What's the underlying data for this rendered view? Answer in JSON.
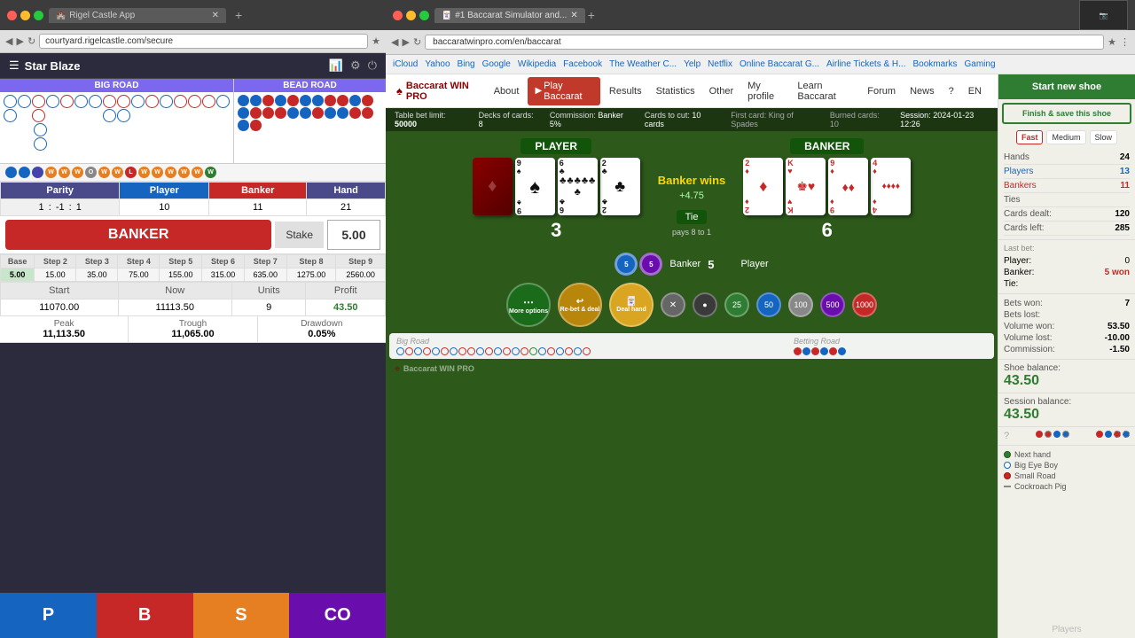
{
  "browser": {
    "tab1": "#1 Baccarat Simulator and...",
    "tab1_url": "baccaratwinpro.com/en/baccarat",
    "left_tab": "Rigel Castle App",
    "left_url": "courtyard.rigelcastle.com/secure"
  },
  "left_panel": {
    "title": "Star Blaze",
    "big_road_label": "BIG ROAD",
    "bead_road_label": "BEAD ROAD",
    "parity_label": "Parity",
    "player_label": "Player",
    "banker_label": "Banker",
    "hand_label": "Hand",
    "parity_1": "1",
    "parity_sep": ":",
    "parity_neg1": "-1",
    "parity_colon2": ":",
    "parity_1b": "1",
    "player_val": "10",
    "banker_val": "11",
    "hand_val": "21",
    "banker_btn_label": "BANKER",
    "stake_label": "Stake",
    "stake_value": "5.00",
    "base_label": "Base",
    "step2": "Step 2",
    "step3": "Step 3",
    "step4": "Step 4",
    "step5": "Step 5",
    "step6": "Step 6",
    "step7": "Step 7",
    "step8": "Step 8",
    "step9": "Step 9",
    "base_val": "5.00",
    "s2_val": "15.00",
    "s3_val": "35.00",
    "s4_val": "75.00",
    "s5_val": "155.00",
    "s6_val": "315.00",
    "s7_val": "635.00",
    "s8_val": "1275.00",
    "s9_val": "2560.00",
    "start_label": "Start",
    "now_label": "Now",
    "units_label": "Units",
    "profit_label": "Profit",
    "start_val": "11070.00",
    "now_val": "11113.50",
    "units_val": "9",
    "profit_val": "43.50",
    "peak_label": "Peak",
    "trough_label": "Trough",
    "drawdown_label": "Drawdown",
    "peak_val": "11,113.50",
    "trough_val": "11,065.00",
    "drawdown_val": "0.05%",
    "btn_p": "P",
    "btn_b": "B",
    "btn_s": "S",
    "btn_co": "CO"
  },
  "nav": {
    "logo": "Baccarat WIN PRO",
    "about": "About",
    "play_baccarat": "Play Baccarat",
    "results": "Results",
    "statistics": "Statistics",
    "other": "Other",
    "my_profile": "My profile",
    "learn": "Learn Baccarat",
    "forum": "Forum",
    "news": "News",
    "help": "Help",
    "lang": "EN"
  },
  "table_info": {
    "table_bet": "Table bet limit:",
    "table_bet_val": "50000",
    "decks": "Decks of cards:",
    "decks_val": "8",
    "commission": "Commission:",
    "commission_val": "Banker 5%",
    "cards_to_cut": "Cards to cut:",
    "cards_to_cut_val": "10 cards",
    "first_card": "First card: King of Spades",
    "burned": "Burned cards: 10",
    "session": "Session: 2024-01-23 12:26"
  },
  "game": {
    "player_label": "PLAYER",
    "banker_label": "BANKER",
    "player_score": "3",
    "banker_score": "6",
    "winner": "Banker wins",
    "winner_sub": "+4.75",
    "tie_label": "Tie",
    "tie_sub": "pays 8 to 1",
    "banker_bet_label": "Banker",
    "banker_bet_amt": "5",
    "player_area_label": "Player",
    "more_options": "More options",
    "rebet": "Re-bet & deal",
    "deal_hand": "Deal hand"
  },
  "sidebar": {
    "start_new_shoe": "Start new shoe",
    "finish_save": "Finish & save this shoe",
    "fast": "Fast",
    "medium": "Medium",
    "slow": "Slow",
    "hands_label": "Hands",
    "hands_val": "24",
    "players_label": "Players",
    "players_val": "13",
    "bankers_label": "Bankers",
    "bankers_val": "11",
    "ties_label": "Ties",
    "ties_val": "",
    "cards_dealt_label": "Cards dealt:",
    "cards_dealt_val": "120",
    "cards_left_label": "Cards left:",
    "cards_left_val": "285",
    "last_bet_title": "Last bet:",
    "player_bet": "Player:",
    "player_bet_val": "0",
    "banker_bet": "Banker:",
    "banker_bet_val": "5 won",
    "tie_bet": "Tie:",
    "tie_bet_val": "",
    "bets_won": "Bets won:",
    "bets_won_val": "7",
    "bets_lost": "Bets lost:",
    "bets_lost_val": "",
    "vol_won": "Volume won:",
    "vol_won_val": "53.50",
    "vol_lost": "Volume lost:",
    "vol_lost_val": "-10.00",
    "commission": "Commission:",
    "commission_val": "-1.50",
    "shoe_balance_label": "Shoe balance:",
    "shoe_balance_val": "43.50",
    "session_balance_label": "Session balance:",
    "session_balance_val": "43.50",
    "players_text": "Players",
    "next_hand": "Next hand",
    "big_eye_boy": "Big Eye Boy",
    "small_road": "Small Road",
    "cockroach": "Cockroach Pig"
  }
}
